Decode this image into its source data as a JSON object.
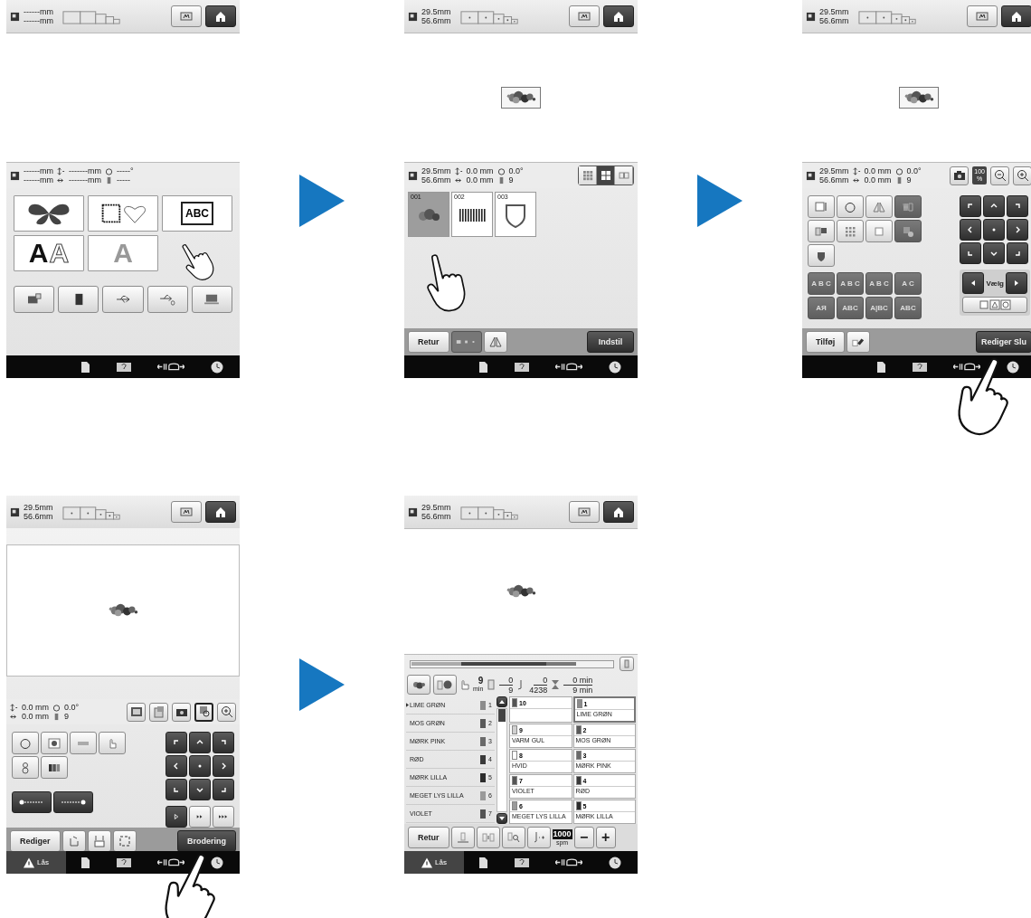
{
  "screens": [
    {
      "kind": "category",
      "header": {
        "size": [
          "------mm",
          "------mm"
        ],
        "hoop_marks": false
      },
      "canvas": {
        "pattern": false
      },
      "info": {
        "size": [
          "------mm",
          "------mm"
        ],
        "offset": [
          "-------mm",
          "-------mm"
        ],
        "angle": "-----°",
        "colors": "-----"
      },
      "categories": [
        {
          "kind": "decorative"
        },
        {
          "kind": "frame"
        },
        {
          "kind": "monogram",
          "text": "ABC"
        },
        {
          "kind": "font",
          "letters": [
            "A",
            "A"
          ]
        },
        {
          "kind": "font",
          "letters": [
            "A"
          ]
        }
      ],
      "sources": [
        {
          "kind": "machine"
        },
        {
          "kind": "card"
        },
        {
          "kind": "usb"
        },
        {
          "kind": "usb_mouse"
        },
        {
          "kind": "computer"
        }
      ]
    },
    {
      "kind": "list",
      "header": {
        "size": [
          "29.5mm",
          "56.6mm"
        ],
        "hoop_marks": true
      },
      "canvas": {
        "pattern": true,
        "frame": true
      },
      "info": {
        "size": [
          "29.5mm",
          "56.6mm"
        ],
        "offset": [
          "0.0 mm",
          "0.0 mm"
        ],
        "angle": "0.0°",
        "colors": "9"
      },
      "views": [
        {
          "kind": "grid9",
          "selected": false
        },
        {
          "kind": "grid4",
          "selected": true
        },
        {
          "kind": "grid2",
          "selected": false
        }
      ],
      "thumbnails": [
        {
          "number": "001",
          "kind": "flowers",
          "selected": true
        },
        {
          "number": "002",
          "kind": "bars",
          "selected": false
        },
        {
          "number": "003",
          "kind": "shield",
          "selected": false
        }
      ],
      "buttons": {
        "back": "Retur",
        "set": "Indstil"
      }
    },
    {
      "kind": "edit",
      "header": {
        "size": [
          "29.5mm",
          "56.6mm"
        ],
        "hoop_marks": true
      },
      "canvas": {
        "pattern": true,
        "frame": true
      },
      "info": {
        "size": [
          "29.5mm",
          "56.6mm"
        ],
        "offset": [
          "0.0 mm",
          "0.0 mm"
        ],
        "angle": "0.0°",
        "colors": "9"
      },
      "zoom": {
        "value": "100",
        "unit": "%"
      },
      "tools": [
        {
          "kind": "size",
          "disabled": false
        },
        {
          "kind": "rotate",
          "disabled": false
        },
        {
          "kind": "mirror",
          "disabled": false
        },
        {
          "kind": "density",
          "disabled": true
        },
        {
          "kind": "colors",
          "disabled": false
        },
        {
          "kind": "array",
          "disabled": false
        },
        {
          "kind": "border",
          "disabled": false
        },
        {
          "kind": "applique_piece",
          "disabled": true
        },
        {
          "kind": "applique",
          "disabled": false
        }
      ],
      "text_tools": [
        {
          "label": "A B C",
          "disabled": true
        },
        {
          "label": "A B C",
          "disabled": true
        },
        {
          "label": "A B C",
          "disabled": true
        },
        {
          "label": "A C",
          "disabled": true
        },
        {
          "label": "AЯ",
          "disabled": true
        },
        {
          "label": "ABC",
          "disabled": true
        },
        {
          "label": "A|BC",
          "disabled": true
        },
        {
          "label": "ABC",
          "disabled": true
        }
      ],
      "select": {
        "label": "Vælg"
      },
      "buttons": {
        "add": "Tilføj",
        "end": "Rediger Slu"
      }
    },
    {
      "kind": "embroider_setup",
      "header": {
        "size": [
          "29.5mm",
          "56.6mm"
        ],
        "hoop_marks": true
      },
      "canvas": {
        "pattern": true,
        "frame": false
      },
      "info": {
        "offset": [
          "0.0 mm",
          "0.0 mm"
        ],
        "angle": "0.0°",
        "colors": "9"
      },
      "views": [
        {
          "kind": "background",
          "selected": false
        },
        {
          "kind": "layout",
          "selected": false
        },
        {
          "kind": "camera",
          "selected": false
        },
        {
          "kind": "preview",
          "selected": true
        },
        {
          "kind": "zoom",
          "selected": false
        }
      ],
      "speeds": [
        {
          "kind": "slow",
          "selected": true
        },
        {
          "kind": "medium",
          "selected": false
        },
        {
          "kind": "fast",
          "selected": false
        }
      ],
      "buttons": {
        "edit": "Rediger",
        "embroider": "Brodering"
      },
      "footer": {
        "lock": "Lås"
      }
    },
    {
      "kind": "embroider",
      "header": {
        "size": [
          "29.5mm",
          "56.6mm"
        ],
        "hoop_marks": true
      },
      "canvas": {
        "pattern": true,
        "frame": false
      },
      "progress": {
        "level": 0.82
      },
      "stats": {
        "time": "9",
        "time_unit": "min",
        "colors_done": "0",
        "colors_total": "9",
        "stitches_done": "0",
        "stitches_total": "4238",
        "time_done": "0 min",
        "time_total": "9 min"
      },
      "threads": [
        {
          "name": "LIME GRØN",
          "number": "1",
          "color": "#8c8c8c",
          "current": true
        },
        {
          "name": "MOS GRØN",
          "number": "2",
          "color": "#5a5a5a",
          "current": false
        },
        {
          "name": "MØRK PINK",
          "number": "3",
          "color": "#6a6a6a",
          "current": false
        },
        {
          "name": "RØD",
          "number": "4",
          "color": "#3a3a3a",
          "current": false
        },
        {
          "name": "MØRK LILLA",
          "number": "5",
          "color": "#2c2c2c",
          "current": false
        },
        {
          "name": "MEGET LYS LILLA",
          "number": "6",
          "color": "#9a9a9a",
          "current": false
        },
        {
          "name": "VIOLET",
          "number": "7",
          "color": "#555555",
          "current": false
        }
      ],
      "needles": [
        {
          "number": "10",
          "color": "#555555",
          "selected": false
        },
        {
          "number": "1",
          "name": "LIME GRØN",
          "color": "#8c8c8c",
          "selected": true
        },
        {
          "number": "9",
          "name": "VARM GUL",
          "color": "#d0d0d0",
          "selected": false
        },
        {
          "number": "2",
          "name": "MOS GRØN",
          "color": "#5a5a5a",
          "selected": false
        },
        {
          "number": "8",
          "name": "HVID",
          "color": "#ffffff",
          "selected": false
        },
        {
          "number": "3",
          "name": "MØRK PINK",
          "color": "#6a6a6a",
          "selected": false
        },
        {
          "number": "7",
          "name": "VIOLET",
          "color": "#555555",
          "selected": false
        },
        {
          "number": "4",
          "name": "RØD",
          "color": "#3a3a3a",
          "selected": false
        },
        {
          "number": "6",
          "name": "MEGET LYS LILLA",
          "color": "#9a9a9a",
          "selected": false
        },
        {
          "number": "5",
          "name": "MØRK LILLA",
          "color": "#2c2c2c",
          "selected": false
        }
      ],
      "speed": {
        "value": "1000",
        "unit": "spm",
        "minus": "−",
        "plus": "+"
      },
      "buttons": {
        "back": "Retur"
      },
      "footer": {
        "lock": "Lås"
      }
    }
  ]
}
